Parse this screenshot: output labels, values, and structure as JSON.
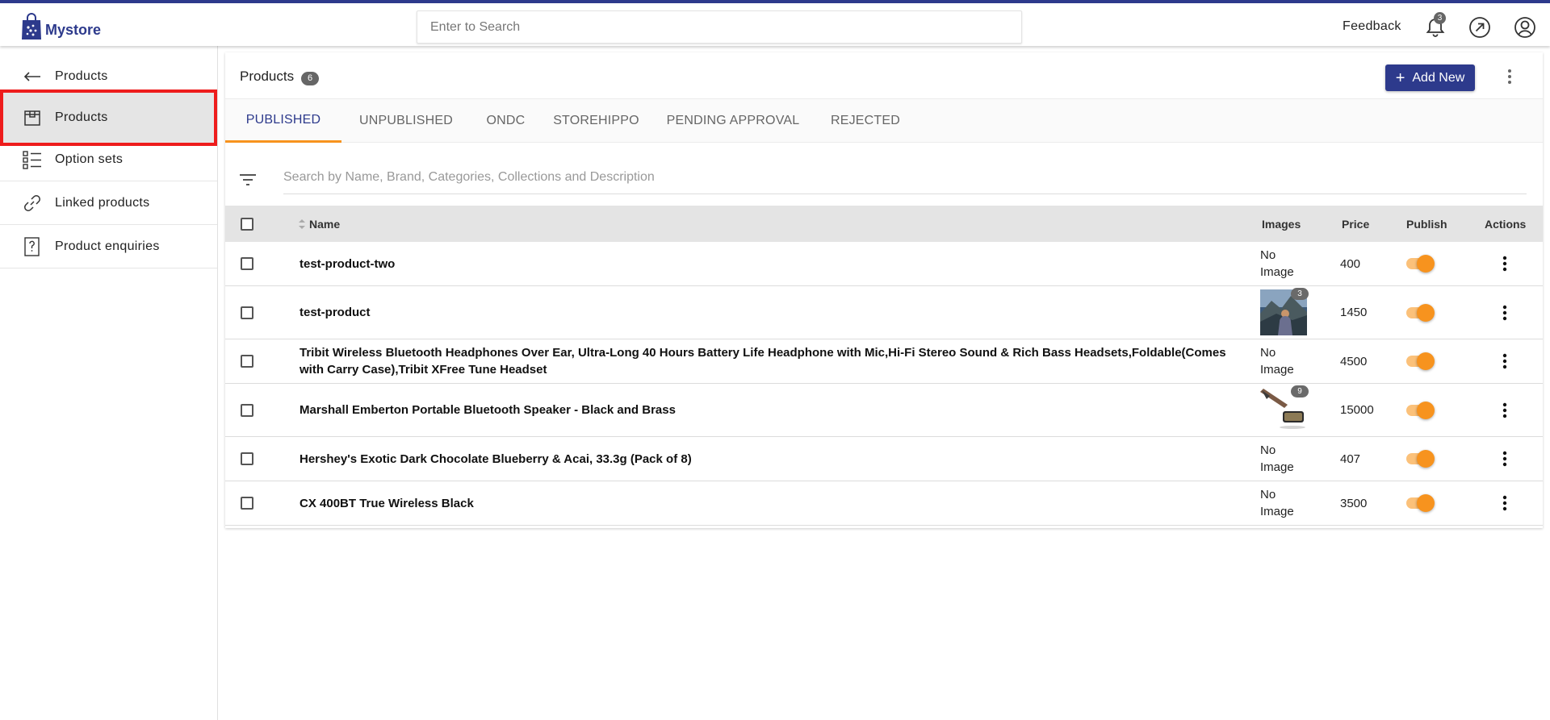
{
  "app": {
    "name": "Mystore"
  },
  "topbar": {
    "search_placeholder": "Enter to Search",
    "feedback_label": "Feedback",
    "notification_count": "3"
  },
  "sidebar": {
    "back_label": "Products",
    "items": [
      {
        "label": "Products",
        "icon": "product-box-icon",
        "active": true
      },
      {
        "label": "Option sets",
        "icon": "list-checklist-icon"
      },
      {
        "label": "Linked products",
        "icon": "link-icon"
      },
      {
        "label": "Product enquiries",
        "icon": "question-icon"
      }
    ]
  },
  "main": {
    "title": "Products",
    "count": "6",
    "add_new_label": "Add New",
    "tabs": [
      {
        "label": "PUBLISHED",
        "active": true
      },
      {
        "label": "UNPUBLISHED"
      },
      {
        "label": "ONDC"
      },
      {
        "label": "STOREHIPPO"
      },
      {
        "label": "PENDING APPROVAL"
      },
      {
        "label": "REJECTED"
      }
    ],
    "search_placeholder": "Search by Name, Brand, Categories, Collections and Description",
    "columns": {
      "name": "Name",
      "images": "Images",
      "price": "Price",
      "publish": "Publish",
      "actions": "Actions"
    },
    "rows": [
      {
        "name": "test-product-two",
        "image": "No Image",
        "price": "400",
        "published": true
      },
      {
        "name": "test-product",
        "image_count": "3",
        "price": "1450",
        "published": true
      },
      {
        "name": "Tribit Wireless Bluetooth Headphones Over Ear, Ultra-Long 40 Hours Battery Life Headphone with Mic,Hi-Fi Stereo Sound & Rich Bass Headsets,Foldable(Comes with Carry Case),Tribit XFree Tune Headset",
        "image": "No Image",
        "price": "4500",
        "published": true
      },
      {
        "name": "Marshall Emberton Portable Bluetooth Speaker - Black and Brass",
        "image_count": "9",
        "price": "15000",
        "published": true
      },
      {
        "name": "Hershey's Exotic Dark Chocolate Blueberry & Acai, 33.3g (Pack of 8)",
        "image": "No Image",
        "price": "407",
        "published": true
      },
      {
        "name": "CX 400BT True Wireless Black",
        "image": "No Image",
        "price": "3500",
        "published": true
      }
    ]
  },
  "colors": {
    "brand": "#2d3a8c",
    "accent": "#f7931e",
    "highlight": "#ee1c1c"
  }
}
